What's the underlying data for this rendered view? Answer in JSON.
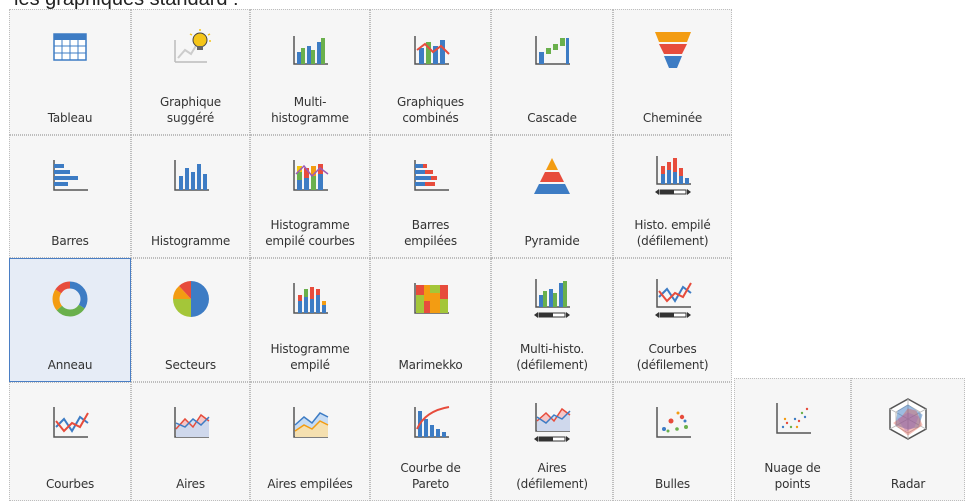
{
  "header": {
    "title": "les graphiques standard :"
  },
  "colors": {
    "selected_border": "#4a7ec4",
    "selected_bg": "#e6ecf6",
    "tile_bg": "#f6f6f6"
  },
  "charts": {
    "tableau": {
      "label": "Tableau",
      "icon": "table-icon"
    },
    "suggere": {
      "label": "Graphique\nsuggéré",
      "icon": "lightbulb-chart-icon"
    },
    "multi_histo": {
      "label": "Multi-\nhistogramme",
      "icon": "multi-histogram-icon"
    },
    "combines": {
      "label": "Graphiques\ncombinés",
      "icon": "combined-chart-icon"
    },
    "cascade": {
      "label": "Cascade",
      "icon": "waterfall-icon"
    },
    "cheminee": {
      "label": "Cheminée",
      "icon": "funnel-icon"
    },
    "barres": {
      "label": "Barres",
      "icon": "bar-chart-icon"
    },
    "histogramme": {
      "label": "Histogramme",
      "icon": "histogram-icon"
    },
    "histo_empile_courbes": {
      "label": "Histogramme\nempilé courbes",
      "icon": "stacked-histogram-lines-icon"
    },
    "barres_empilees": {
      "label": "Barres\nempilées",
      "icon": "stacked-bars-icon"
    },
    "pyramide": {
      "label": "Pyramide",
      "icon": "pyramid-icon"
    },
    "histo_empile_defil": {
      "label": "Histo. empilé\n(défilement)",
      "icon": "stacked-histogram-scroll-icon"
    },
    "anneau": {
      "label": "Anneau",
      "icon": "donut-icon",
      "selected": true
    },
    "secteurs": {
      "label": "Secteurs",
      "icon": "pie-icon"
    },
    "histo_empile": {
      "label": "Histogramme\nempilé",
      "icon": "stacked-histogram-icon"
    },
    "marimekko": {
      "label": "Marimekko",
      "icon": "marimekko-icon"
    },
    "multi_histo_defil": {
      "label": "Multi-histo.\n(défilement)",
      "icon": "multi-histogram-scroll-icon"
    },
    "courbes_defil": {
      "label": "Courbes\n(défilement)",
      "icon": "lines-scroll-icon"
    },
    "courbes": {
      "label": "Courbes",
      "icon": "lines-icon"
    },
    "aires": {
      "label": "Aires",
      "icon": "area-icon"
    },
    "aires_empilees": {
      "label": "Aires empilées",
      "icon": "stacked-area-icon"
    },
    "pareto": {
      "label": "Courbe de\nPareto",
      "icon": "pareto-icon"
    },
    "aires_defil": {
      "label": "Aires\n(défilement)",
      "icon": "area-scroll-icon"
    },
    "bulles": {
      "label": "Bulles",
      "icon": "bubble-icon"
    },
    "nuage": {
      "label": "Nuage de\npoints",
      "icon": "scatter-icon"
    },
    "radar": {
      "label": "Radar",
      "icon": "radar-icon"
    }
  }
}
